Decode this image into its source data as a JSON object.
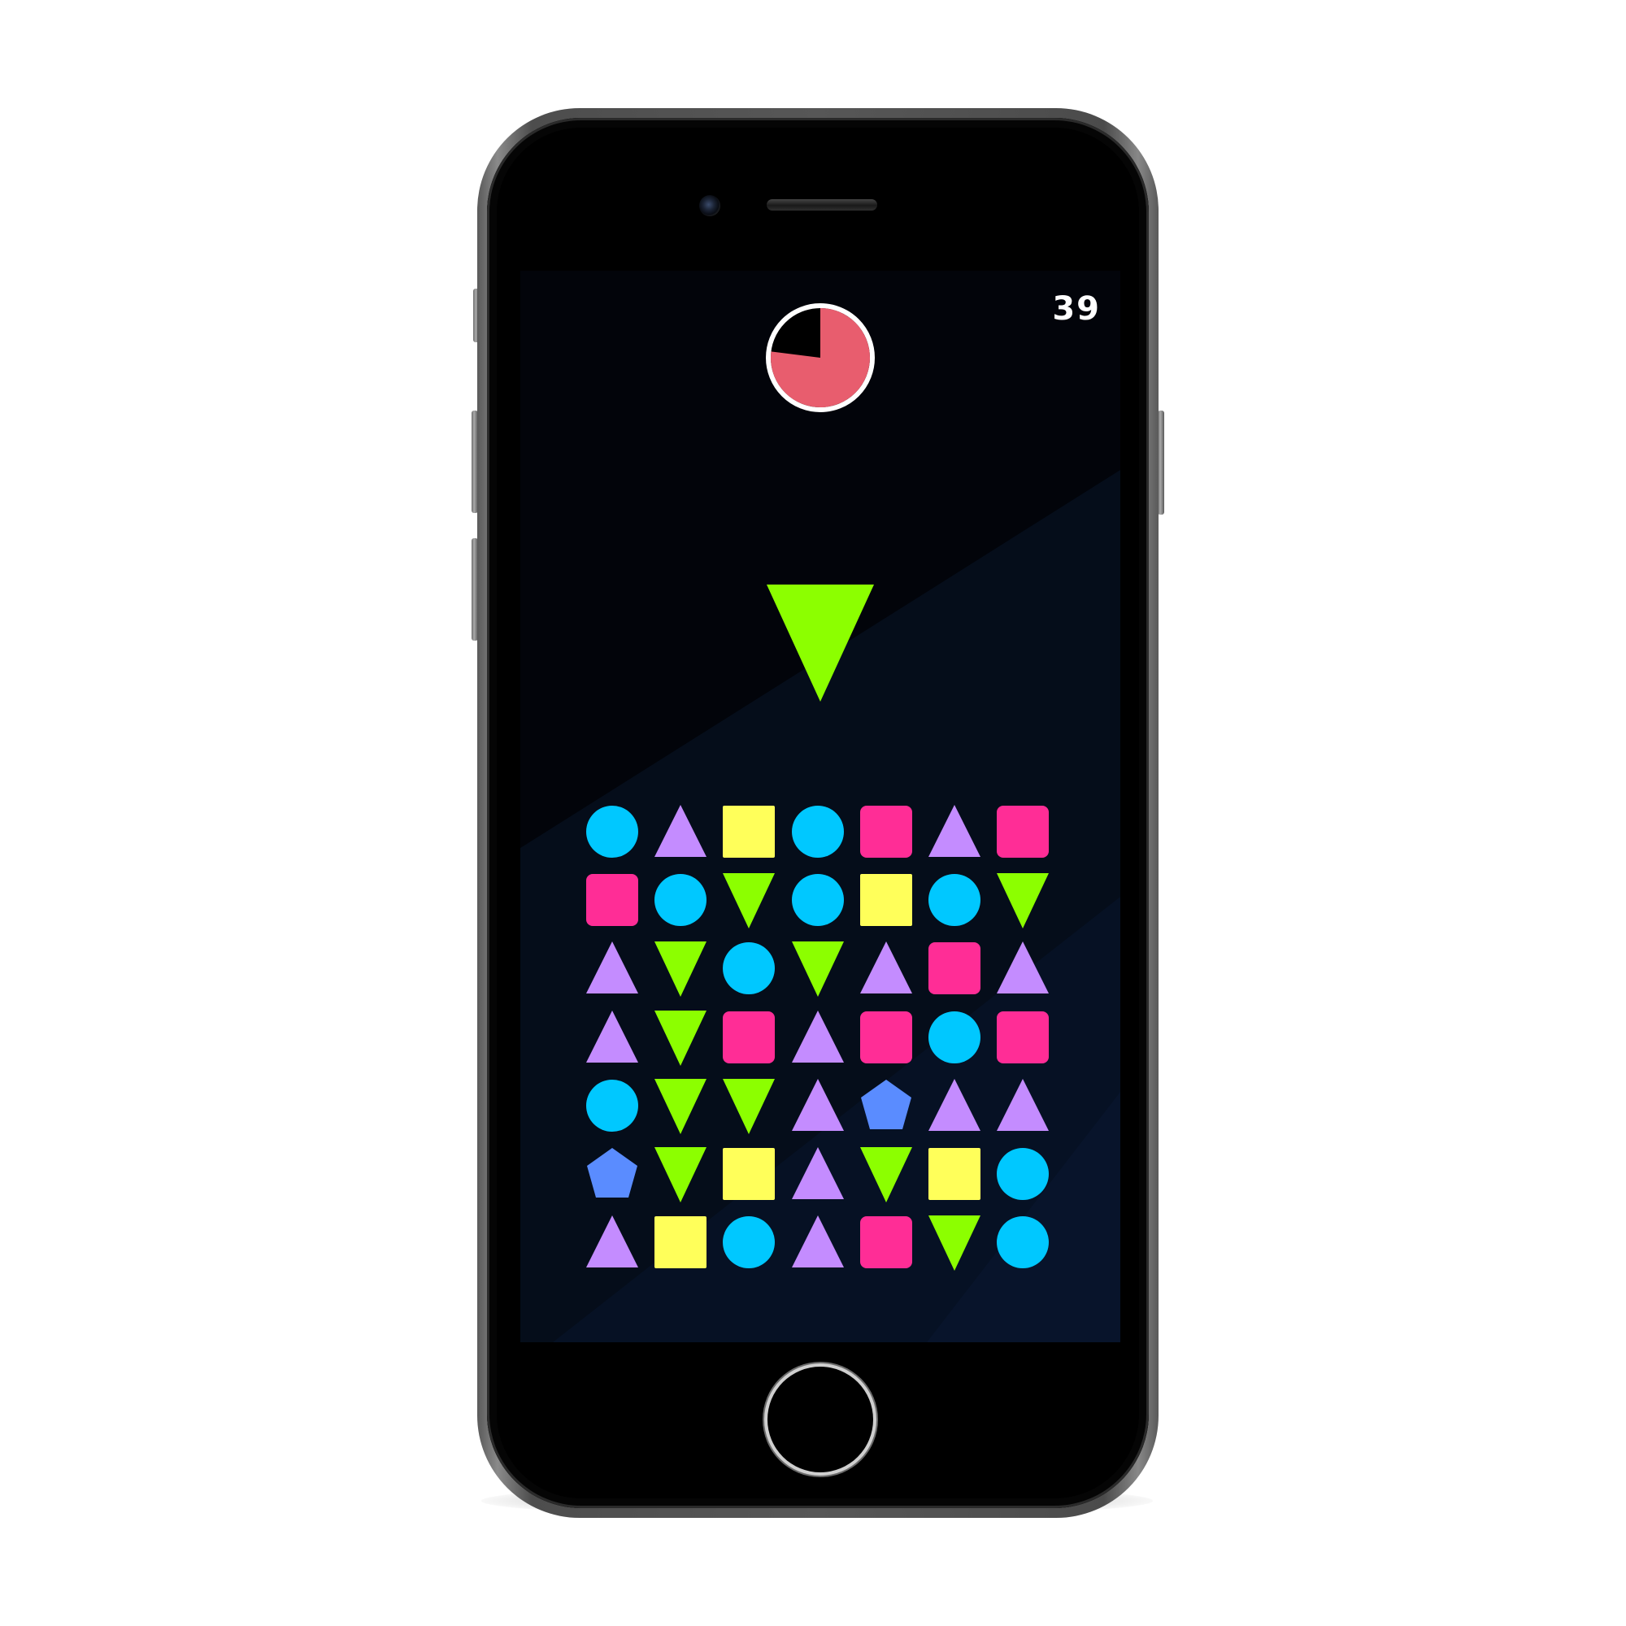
{
  "score": "39",
  "timer": {
    "remaining_fraction": 0.77,
    "fill_color": "#e85d6e",
    "ring_color": "#ffffff"
  },
  "target": {
    "shape": "triangle-down",
    "color": "#8cff00"
  },
  "colors": {
    "circle": "#00c8ff",
    "triangle-up": "#c48cff",
    "square-yellow": "#ffff5a",
    "square-pink": "#ff2d96",
    "triangle-down": "#8cff00",
    "pentagon": "#5a8cff"
  },
  "grid": [
    [
      "circle",
      "triangle-up",
      "square-yellow",
      "circle",
      "square-pink",
      "triangle-up",
      "square-pink"
    ],
    [
      "square-pink",
      "circle",
      "triangle-down",
      "circle",
      "square-yellow",
      "circle",
      "triangle-down"
    ],
    [
      "triangle-up",
      "triangle-down",
      "circle",
      "triangle-down",
      "triangle-up",
      "square-pink",
      "triangle-up"
    ],
    [
      "triangle-up",
      "triangle-down",
      "square-pink",
      "triangle-up",
      "square-pink",
      "circle",
      "square-pink"
    ],
    [
      "circle",
      "triangle-down",
      "triangle-down",
      "triangle-up",
      "pentagon",
      "triangle-up",
      "triangle-up"
    ],
    [
      "pentagon",
      "triangle-down",
      "square-yellow",
      "triangle-up",
      "triangle-down",
      "square-yellow",
      "circle"
    ],
    [
      "triangle-up",
      "square-yellow",
      "circle",
      "triangle-up",
      "square-pink",
      "triangle-down",
      "circle"
    ]
  ]
}
